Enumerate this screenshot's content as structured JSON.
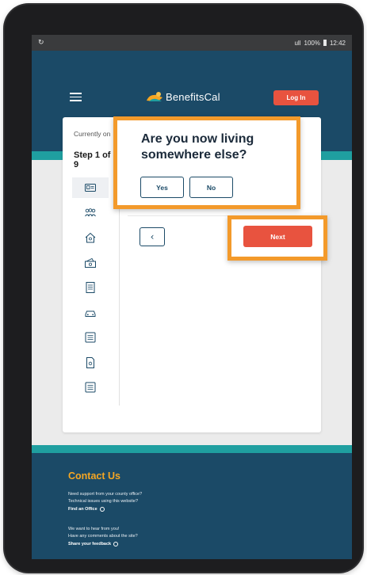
{
  "status_bar": {
    "left_icon": "sync-icon",
    "signal": "ull",
    "battery_text": "100%",
    "time": "12:42"
  },
  "header": {
    "logo_text": "BenefitsCal",
    "login_label": "Log In"
  },
  "progress": {
    "currently_label": "Currently on",
    "step_label": "Step 1 of 9"
  },
  "steps": [
    {
      "icon": "id-card-icon",
      "active": true
    },
    {
      "icon": "people-icon",
      "active": false
    },
    {
      "icon": "home-icon",
      "active": false
    },
    {
      "icon": "money-icon",
      "active": false
    },
    {
      "icon": "document-icon",
      "active": false
    },
    {
      "icon": "car-icon",
      "active": false
    },
    {
      "icon": "list-icon",
      "active": false
    },
    {
      "icon": "file-icon",
      "active": false
    },
    {
      "icon": "checklist-icon",
      "active": false
    }
  ],
  "question": {
    "title": "Are you now living somewhere else?",
    "yes_label": "Yes",
    "no_label": "No"
  },
  "navigation": {
    "back_label": "‹",
    "next_label": "Next"
  },
  "footer": {
    "title": "Contact Us",
    "line1": "Need support from your county office?",
    "line2": "Technical issues using this website?",
    "link1": "Find an Office",
    "line3": "We want to hear from you!",
    "line4": "Have any comments about the site?",
    "link2": "Share your feedback"
  },
  "colors": {
    "brand_navy": "#1b4a67",
    "accent_red": "#e8533f",
    "teal": "#1f9fa0",
    "highlight_orange": "#f39a2b",
    "footer_title": "#f5a623"
  }
}
